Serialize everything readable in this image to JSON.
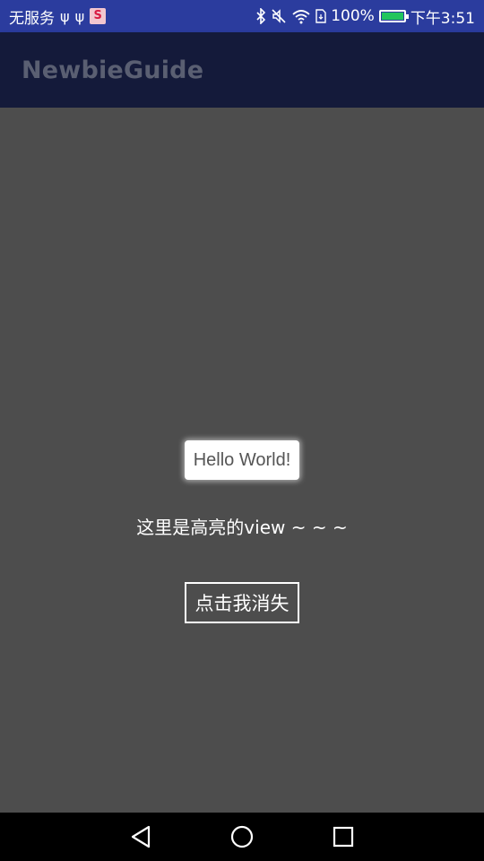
{
  "status_bar": {
    "carrier": "无服务",
    "usb_icons": [
      "ψ",
      "ψ"
    ],
    "app_badge": "S",
    "battery_percent": "100%",
    "battery_level": 1.0,
    "time": "下午3:51",
    "colors": {
      "background": "#2b3c9e",
      "battery_fill": "#22c55e"
    }
  },
  "app_bar": {
    "title": "NewbieGuide",
    "colors": {
      "background": "#141a3a",
      "title": "#5a5f72"
    }
  },
  "content": {
    "hello_button": "Hello World!",
    "highlight_text": "这里是高亮的view ~ ~ ~",
    "dismiss_button": "点击我消失",
    "colors": {
      "overlay": "#4d4d4d"
    }
  },
  "nav_bar": {
    "icons": [
      "back-icon",
      "home-icon",
      "recents-icon"
    ]
  }
}
